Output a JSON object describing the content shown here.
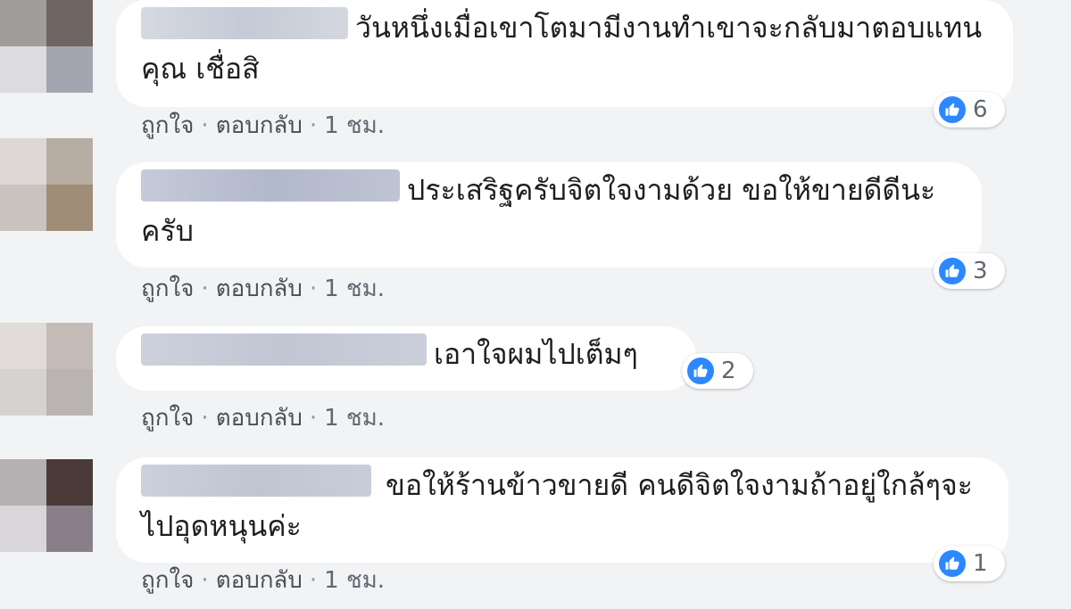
{
  "accent": "#2d88ff",
  "actions": {
    "like": "ถูกใจ",
    "reply": "ตอบกลับ",
    "separator": "·",
    "time": "1 ชม."
  },
  "comments": [
    {
      "text": "วันหนึ่งเมื่อเขาโตมามีงานทำเขาจะกลับมาตอบแทนคุณ เชื่อสิ",
      "likes": "6",
      "avatar_colors": [
        "#a19d9b",
        "#6f6563",
        "#dcdcde",
        "#a3a6b1"
      ],
      "name_blur_colors": [
        "#cfd3de",
        "#c5cad6"
      ]
    },
    {
      "text": "ประเสริฐครับจิตใจงามด้วย ขอให้ขายดีดีนะครับ",
      "likes": "3",
      "avatar_colors": [
        "#ddd8d5",
        "#b7ada3",
        "#c9c3c0",
        "#a08d78"
      ],
      "name_blur_colors": [
        "#c6cad8",
        "#b2b8cc"
      ]
    },
    {
      "text": "เอาใจผมไปเต็มๆ",
      "likes": "2",
      "avatar_colors": [
        "#e0dbd9",
        "#c4bbb7",
        "#d5d2d1",
        "#b9b3b2"
      ],
      "name_blur_colors": [
        "#cdd1dc",
        "#c1c6d3"
      ]
    },
    {
      "text": "ขอให้ร้านข้าวขายดี คนดีจิตใจงามถ้าอยู่ใกล้ๆจะไปอุดหนุนค่ะ",
      "likes": "1",
      "avatar_colors": [
        "#b5b1b2",
        "#4a3b39",
        "#d8d6d9",
        "#8a7f89"
      ],
      "name_blur_colors": [
        "#ccd0dc",
        "#c0c5d2"
      ]
    }
  ]
}
